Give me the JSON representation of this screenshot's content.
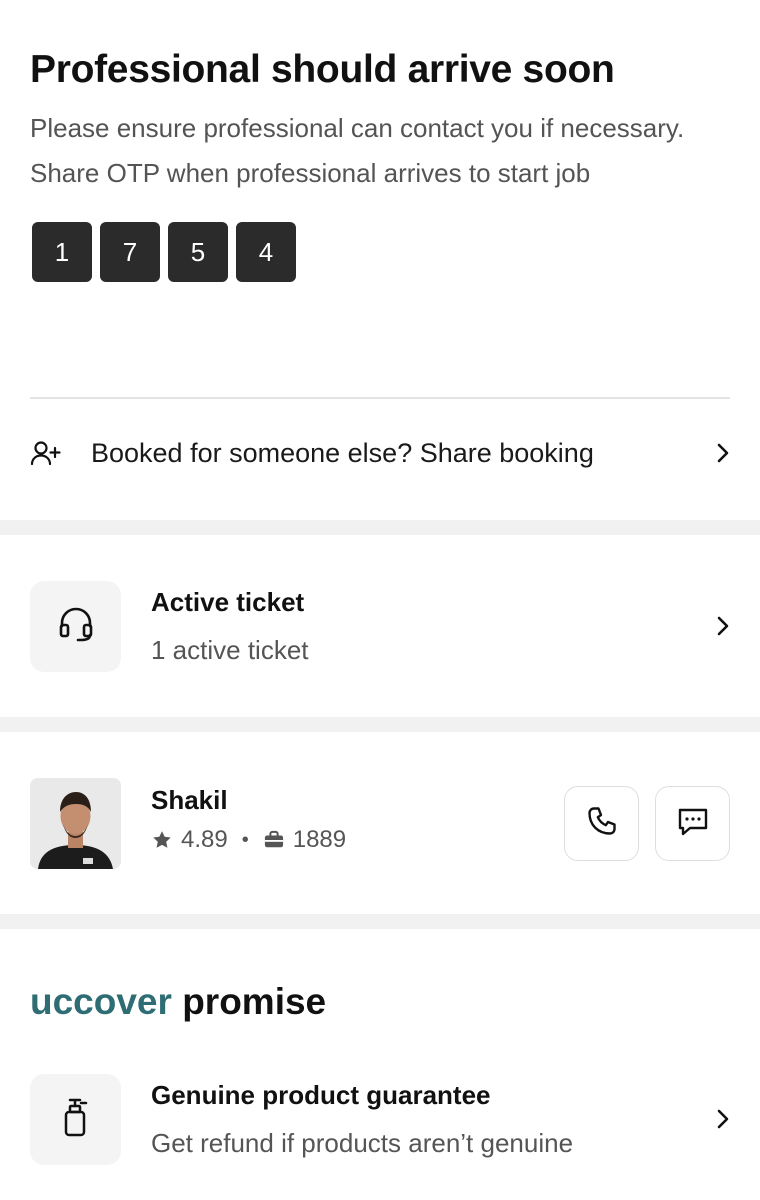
{
  "status": {
    "title": "Professional should arrive soon",
    "description": "Please ensure professional can contact you if necessary. Share OTP when professional arrives to start job",
    "otp": [
      "1",
      "7",
      "5",
      "4"
    ]
  },
  "share_booking": {
    "label": "Booked for someone else? Share booking",
    "icon": "add-person-icon"
  },
  "active_ticket": {
    "title": "Active ticket",
    "subtitle": "1 active ticket",
    "icon": "headset-icon"
  },
  "professional": {
    "name": "Shakil",
    "rating": "4.89",
    "jobs": "1889",
    "rating_icon": "star-icon",
    "jobs_icon": "briefcase-icon",
    "call_icon": "phone-icon",
    "chat_icon": "chat-icon"
  },
  "promise": {
    "brand": "uccover",
    "rest": " promise",
    "brand_color": "#2f6d74"
  },
  "guarantee": {
    "title": "Genuine product guarantee",
    "subtitle": "Get refund if products aren’t genuine",
    "icon": "bottle-icon"
  }
}
